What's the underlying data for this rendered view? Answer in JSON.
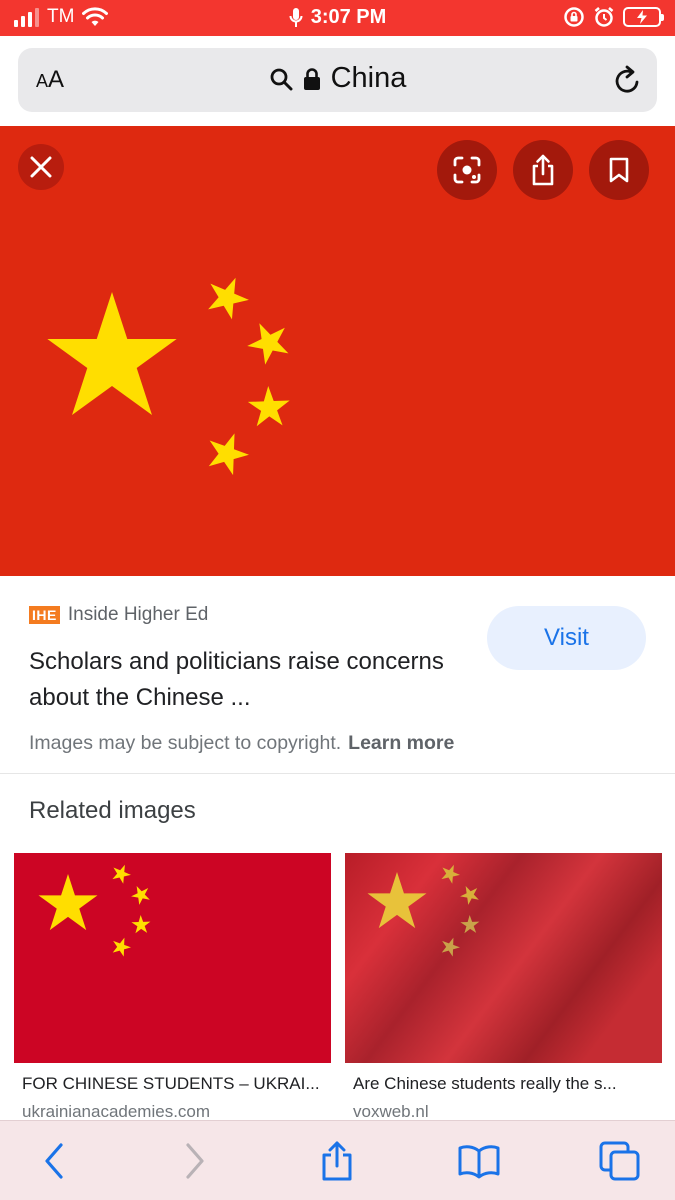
{
  "status_bar": {
    "carrier": "TM",
    "time": "3:07 PM"
  },
  "address_bar": {
    "text_size_label_small": "A",
    "text_size_label_large": "A",
    "query": "China"
  },
  "result": {
    "source_logo": "IHE",
    "source_name": "Inside Higher Ed",
    "headline": "Scholars and politicians raise concerns about the Chinese ...",
    "visit_label": "Visit",
    "copyright_text": "Images may be subject to copyright.",
    "learn_more_label": "Learn more"
  },
  "related": {
    "heading": "Related images",
    "items": [
      {
        "title": "FOR CHINESE STUDENTS – UKRAI...",
        "site": "ukrainianacademies.com"
      },
      {
        "title": "Are Chinese students really the s...",
        "site": "voxweb.nl"
      }
    ]
  },
  "colors": {
    "status_bar": "#f3362f",
    "flag_red": "#de2910",
    "flag_star": "#ffde00",
    "accent": "#1a73e8",
    "toolbar_tint": "#1a73e8"
  },
  "icons": {
    "status": [
      "signal-icon",
      "wifi-icon",
      "microphone-icon",
      "rotation-lock-icon",
      "alarm-icon",
      "battery-charging-icon"
    ],
    "address": [
      "search-icon",
      "lock-icon",
      "reload-icon"
    ],
    "hero": [
      "close-icon",
      "lens-icon",
      "share-icon",
      "bookmark-icon"
    ],
    "toolbar": [
      "back-icon",
      "forward-icon",
      "share-icon",
      "bookmarks-icon",
      "tabs-icon"
    ]
  }
}
